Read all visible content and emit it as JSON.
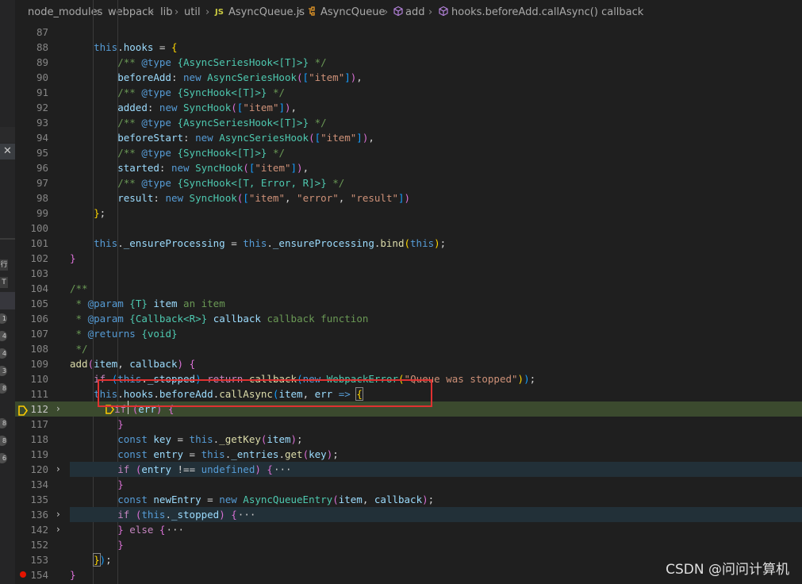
{
  "breadcrumb": {
    "segments": [
      "node_modules",
      "webpack",
      "lib",
      "util"
    ],
    "file_icon": "JS",
    "file": "AsyncQueue.js",
    "class": "AsyncQueue",
    "method": "add",
    "callback": "hooks.beforeAdd.callAsync() callback"
  },
  "sidebar": {
    "close_glyph": "✕",
    "cjk_chars": [
      "行",
      "T"
    ],
    "badges": [
      "1",
      "4",
      "4",
      "3",
      "8",
      "8",
      "8",
      "6"
    ]
  },
  "line_numbers": [
    "87",
    "88",
    "89",
    "90",
    "91",
    "92",
    "93",
    "94",
    "95",
    "96",
    "97",
    "98",
    "99",
    "100",
    "101",
    "102",
    "103",
    "104",
    "105",
    "106",
    "107",
    "108",
    "109",
    "110",
    "111",
    "112",
    "117",
    "118",
    "119",
    "120",
    "134",
    "135",
    "136",
    "142",
    "152",
    "153",
    "154"
  ],
  "folded_lines": [
    "112",
    "120",
    "136",
    "142"
  ],
  "current_line": "112",
  "breakpoint_lines": [
    "154"
  ],
  "code_tokens": {
    "this": "this",
    "hooks": "hooks",
    "new": "new",
    "AsyncSeriesHook": "AsyncSeriesHook",
    "SyncHook": "SyncHook",
    "item_str": "\"item\"",
    "error_str": "\"error\"",
    "result_str": "\"result\"",
    "beforeAdd": "beforeAdd",
    "added": "added",
    "beforeStart": "beforeStart",
    "started": "started",
    "result": "result",
    "type_tag": "@type",
    "param_tag": "@param",
    "returns_tag": "@returns",
    "T": "T",
    "R": "R",
    "Error": "Error",
    "Callback": "Callback",
    "void": "void",
    "item": "item",
    "callback": "callback",
    "an_item": "an item",
    "callback_function": "callback function",
    "_ensureProcessing": "_ensureProcessing",
    "bind": "bind",
    "add": "add",
    "if": "if",
    "_stopped": "_stopped",
    "return": "return",
    "WebpackError": "WebpackError",
    "queue_stopped": "\"Queue was stopped\"",
    "callAsync": "callAsync",
    "err": "err",
    "arrow": "=>",
    "const": "const",
    "key": "key",
    "_getKey": "_getKey",
    "entry": "entry",
    "_entries": "_entries",
    "get": "get",
    "neq": "!==",
    "undefined": "undefined",
    "ellipsis": "···",
    "newEntry": "newEntry",
    "AsyncQueueEntry": "AsyncQueueEntry",
    "else": "else",
    "open_jsdoc": "/**",
    "close_jsdoc": "*/",
    "star": "*"
  },
  "watermark": "CSDN @问问计算机"
}
